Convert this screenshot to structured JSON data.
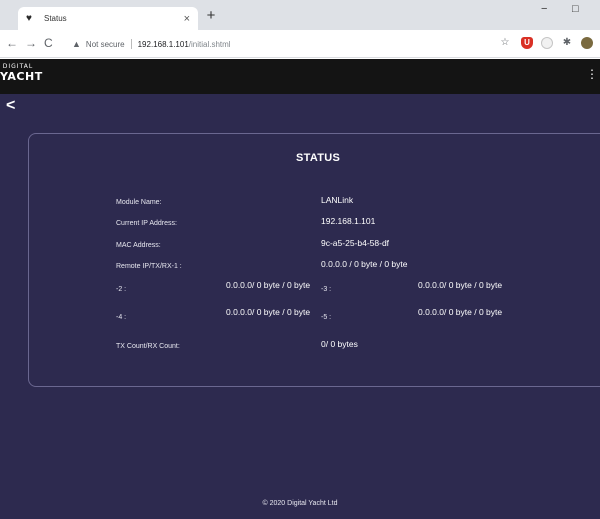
{
  "browser": {
    "tab_title": "Status",
    "tab_close": "×",
    "new_tab": "+",
    "minimize": "−",
    "maximize": "□",
    "nav_back": "←",
    "nav_forward": "→",
    "reload": "C",
    "security_label": "Not secure",
    "url_host": "192.168.1.101",
    "url_path": "/initial.shtml"
  },
  "app": {
    "logo_line1": "DIGITAL",
    "logo_line2": "YACHT",
    "back": "<",
    "menu": "⋮"
  },
  "status": {
    "title": "STATUS",
    "module_name_label": "Module Name:",
    "module_name": "LANLink",
    "ip_label": "Current IP Address:",
    "ip": "192.168.1.101",
    "mac_label": "MAC Address:",
    "mac": "9c-a5-25-b4-58-df",
    "remote1_label": "Remote IP/TX/RX-1 :",
    "remote1": "0.0.0.0 / 0 byte / 0 byte",
    "remote2_label": "-2 :",
    "remote2": "0.0.0.0/ 0 byte / 0 byte",
    "remote3_label": "-3 :",
    "remote3": "0.0.0.0/ 0 byte / 0 byte",
    "remote4_label": "-4 :",
    "remote4": "0.0.0.0/ 0 byte / 0 byte",
    "remote5_label": "-5 :",
    "remote5": "0.0.0.0/ 0 byte / 0 byte",
    "count_label": "TX Count/RX Count:",
    "count": "0/ 0 bytes"
  },
  "footer": "© 2020 Digital Yacht Ltd",
  "colors": {
    "page_bg": "#2d2a4f",
    "header_bg": "#141414"
  }
}
